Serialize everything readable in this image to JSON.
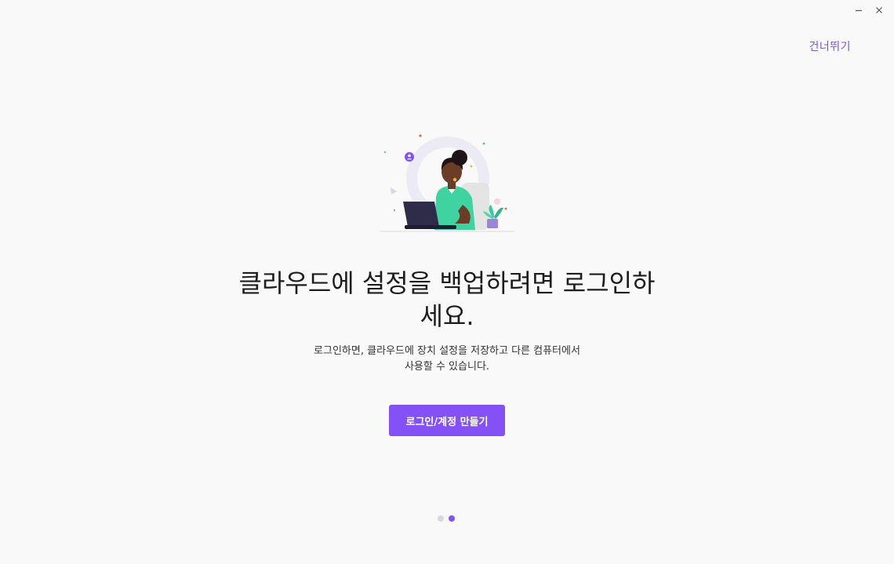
{
  "window": {
    "controls": {
      "minimize_icon": "minimize-icon",
      "close_icon": "close-icon"
    }
  },
  "header": {
    "skip_label": "건너뛰기"
  },
  "main": {
    "illustration": "person-with-laptop-illustration",
    "headline_line1": "클라우드에 설정을 백업하려면 로그인하",
    "headline_line2": "세요.",
    "subtext_line1": "로그인하면, 클라우드에 장치 설정을 저장하고 다른 컴퓨터에서",
    "subtext_line2": "사용할 수 있습니다.",
    "cta_label": "로그인/계정 만들기"
  },
  "pager": {
    "total": 2,
    "active_index": 1
  },
  "colors": {
    "accent": "#8451f6",
    "background": "#f9f9f9",
    "text": "#1d1d1d",
    "dot_inactive": "#d9d6e6"
  }
}
